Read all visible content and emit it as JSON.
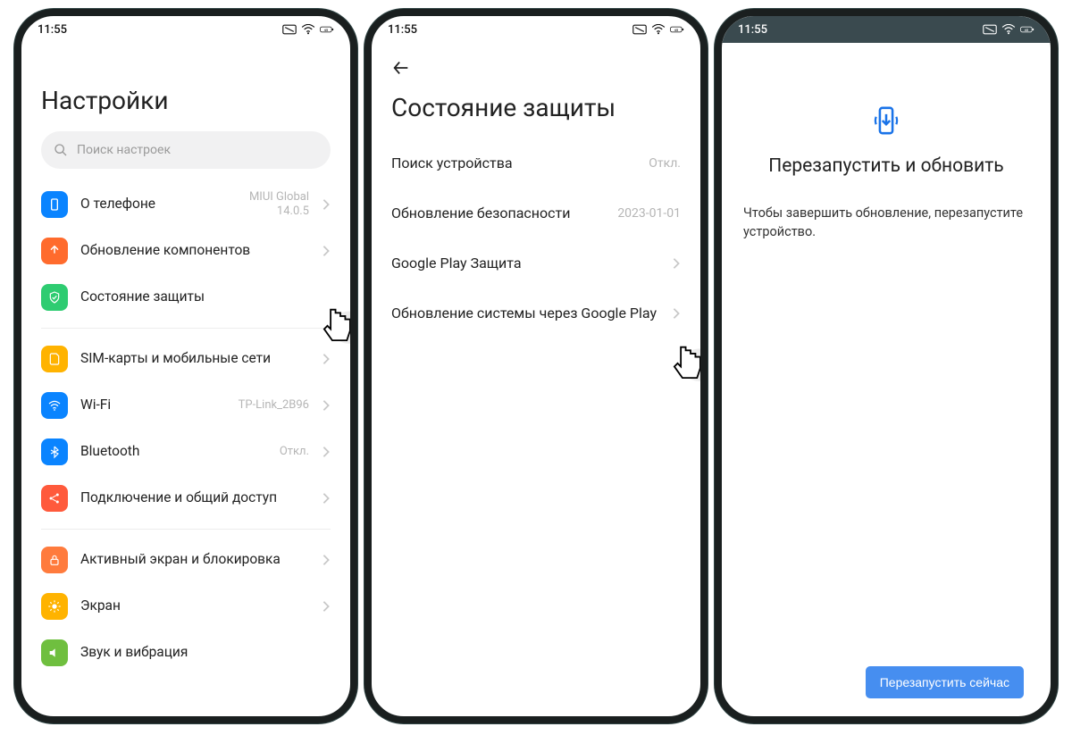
{
  "status": {
    "time": "11:55"
  },
  "screen1": {
    "title": "Настройки",
    "search_placeholder": "Поиск настроек",
    "items": {
      "about": {
        "label": "О телефоне",
        "sub": "MIUI Global\n14.0.5"
      },
      "components": {
        "label": "Обновление компонентов"
      },
      "security": {
        "label": "Состояние защиты"
      },
      "sim": {
        "label": "SIM-карты и мобильные сети"
      },
      "wifi": {
        "label": "Wi-Fi",
        "sub": "TP-Link_2B96"
      },
      "bt": {
        "label": "Bluetooth",
        "sub": "Откл."
      },
      "connect": {
        "label": "Подключение и общий доступ"
      },
      "lock": {
        "label": "Активный экран и блокировка"
      },
      "display": {
        "label": "Экран"
      },
      "sound": {
        "label": "Звук и вибрация"
      }
    }
  },
  "screen2": {
    "title": "Состояние защиты",
    "rows": {
      "find": {
        "label": "Поиск устройства",
        "val": "Откл."
      },
      "secupd": {
        "label": "Обновление безопасности",
        "val": "2023-01-01"
      },
      "play": {
        "label": "Google Play Защита"
      },
      "sysupd": {
        "label": "Обновление системы через Google Play"
      }
    }
  },
  "screen3": {
    "title": "Перезапустить и обновить",
    "body": "Чтобы завершить обновление, перезапустите устройство.",
    "button": "Перезапустить сейчас"
  }
}
